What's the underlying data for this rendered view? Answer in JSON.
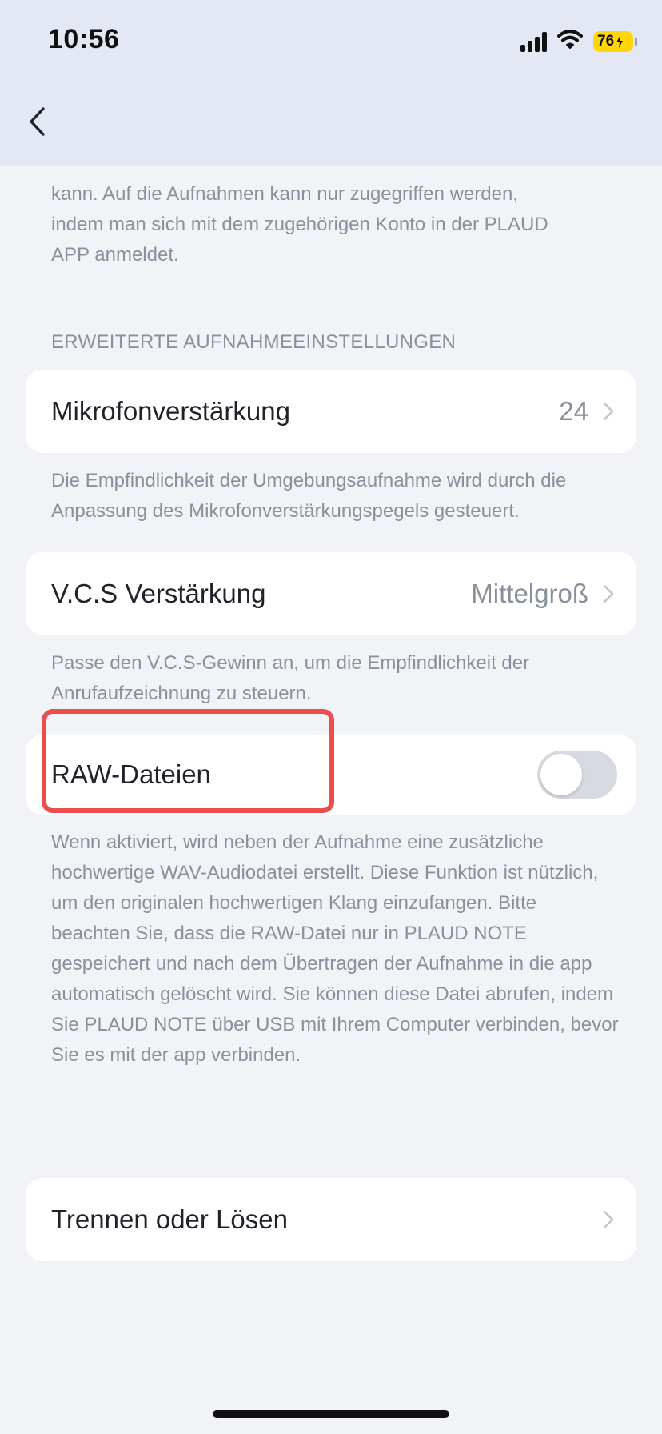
{
  "status_bar": {
    "time": "10:56",
    "battery": "76"
  },
  "nav": {
    "back_icon": "chevron-left-icon"
  },
  "intro_note": {
    "line1": "kann. Auf die Aufnahmen kann nur zugegriffen werden,",
    "line2": "indem man sich mit dem zugehörigen Konto in der PLAUD",
    "line3": "APP anmeldet."
  },
  "section_title": "ERWEITERTE AUFNAHMEEINSTELLUNGEN",
  "mic_gain": {
    "label": "Mikrofonverstärkung",
    "value": "24",
    "note": "Die Empfindlichkeit der Umgebungsaufnahme wird durch die Anpassung des Mikrofonverstärkungspegels gesteuert."
  },
  "vcs_gain": {
    "label": "V.C.S Verstärkung",
    "value": "Mittelgroß",
    "note": "Passe den V.C.S-Gewinn an, um die Empfindlichkeit der Anrufaufzeichnung zu steuern."
  },
  "raw_files": {
    "label": "RAW-Dateien",
    "enabled": false,
    "note": "Wenn aktiviert, wird neben der Aufnahme eine zusätzliche hochwertige WAV-Audiodatei erstellt. Diese Funktion ist nützlich, um den originalen hochwertigen Klang einzufangen. Bitte beachten Sie, dass die RAW-Datei nur in PLAUD NOTE gespeichert und nach dem Übertragen der Aufnahme in die app automatisch gelöscht wird. Sie können diese Datei abrufen, indem Sie PLAUD NOTE über USB mit Ihrem Computer verbinden, bevor Sie es mit der app verbinden."
  },
  "disconnect": {
    "label": "Trennen oder Lösen"
  },
  "colors": {
    "background": "#f2f3f7",
    "header": "#e3e8f4",
    "card": "#ffffff",
    "secondary_text": "#8a909c",
    "highlight": "#eb4c4c",
    "battery": "#ffd60a"
  }
}
